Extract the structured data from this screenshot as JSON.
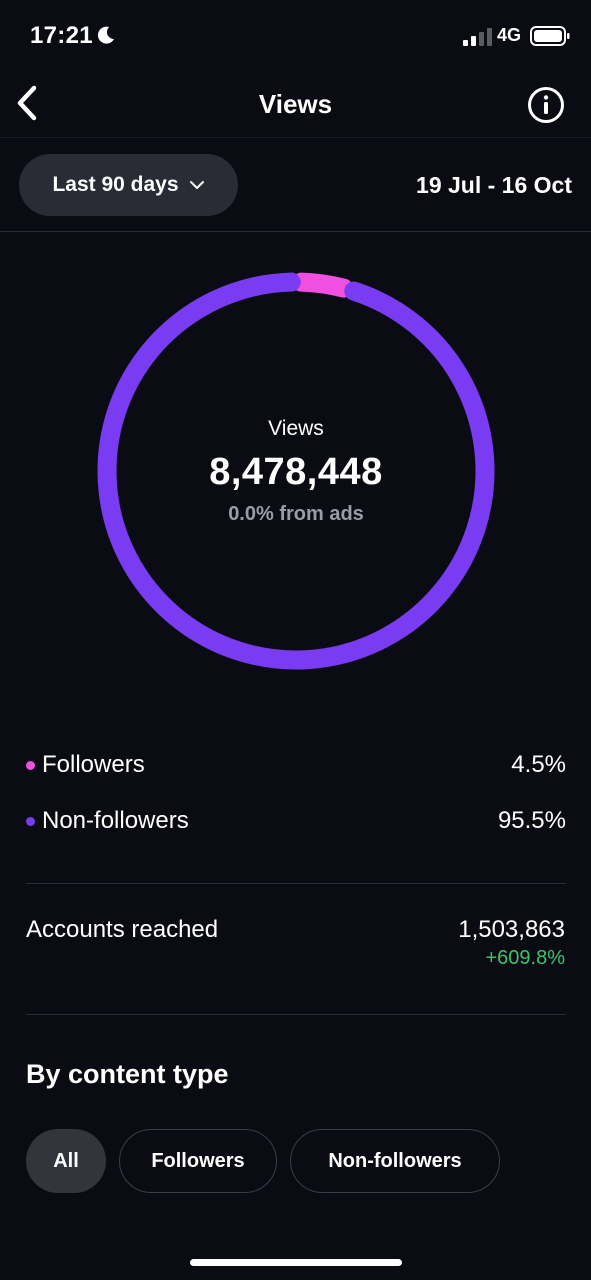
{
  "status_bar": {
    "time": "17:21",
    "network": "4G",
    "moon_icon": "moon-icon",
    "signal_icon": "signal-icon",
    "battery_icon": "battery-icon"
  },
  "header": {
    "title": "Views",
    "back_icon": "chevron-left-icon",
    "info_icon": "info-icon"
  },
  "filter": {
    "range_label": "Last 90 days",
    "date_range": "19 Jul - 16 Oct"
  },
  "donut": {
    "label": "Views",
    "value": "8,478,448",
    "subtext": "0.0% from ads",
    "colors": {
      "followers": "#f04fe0",
      "non_followers": "#7a3cf3"
    },
    "followers_share": 4.5,
    "non_followers_share": 95.5
  },
  "legend": [
    {
      "label": "Followers",
      "value": "4.5%",
      "color": "#f04fe0"
    },
    {
      "label": "Non-followers",
      "value": "95.5%",
      "color": "#7a3cf3"
    }
  ],
  "accounts_reached": {
    "label": "Accounts reached",
    "value": "1,503,863",
    "change": "+609.8%",
    "change_color": "#3cc26e"
  },
  "content_type": {
    "title": "By content type",
    "chips": [
      {
        "label": "All",
        "selected": true
      },
      {
        "label": "Followers",
        "selected": false
      },
      {
        "label": "Non-followers",
        "selected": false
      }
    ]
  }
}
